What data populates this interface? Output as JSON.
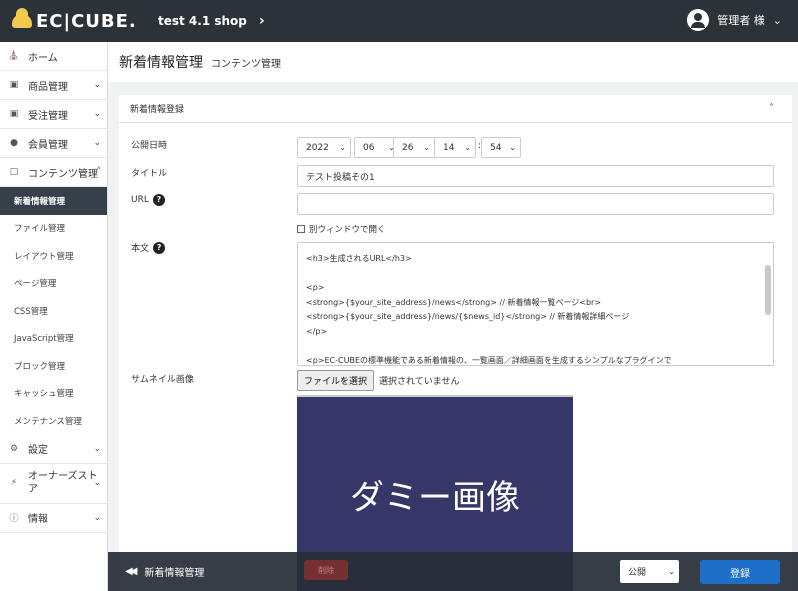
{
  "topbar": {
    "logo_text": "EC|CUBE.",
    "shop_name": "test 4.1 shop",
    "user_name": "管理者 様"
  },
  "sidebar": {
    "items": [
      {
        "label": "ホーム",
        "icon": "home-icon",
        "chevron": ""
      },
      {
        "label": "商品管理",
        "icon": "box-icon",
        "chevron": "⌄"
      },
      {
        "label": "受注管理",
        "icon": "cart-icon",
        "chevron": "⌄"
      },
      {
        "label": "会員管理",
        "icon": "users-icon",
        "chevron": "⌄"
      },
      {
        "label": "コンテンツ管理",
        "icon": "file-icon",
        "chevron": "^"
      }
    ],
    "subitems": [
      "新着情報管理",
      "ファイル管理",
      "レイアウト管理",
      "ページ管理",
      "CSS管理",
      "JavaScript管理",
      "ブロック管理",
      "キャッシュ管理",
      "メンテナンス管理"
    ],
    "items_after": [
      {
        "label": "設定",
        "icon": "gear-icon",
        "chevron": "⌄"
      },
      {
        "label": "オーナーズストア",
        "icon": "plug-icon",
        "chevron": "⌄"
      },
      {
        "label": "情報",
        "icon": "info-icon",
        "chevron": "⌄"
      }
    ]
  },
  "page": {
    "title": "新着情報管理",
    "subtitle": "コンテンツ管理"
  },
  "form": {
    "card_title": "新着情報登録",
    "date_label": "公開日時",
    "year": "2022",
    "month": "06",
    "day": "26",
    "hour": "14",
    "minute": "54",
    "colon": ":",
    "title_label": "タイトル",
    "title_value": "テスト投稿その1",
    "url_label": "URL",
    "url_value": "",
    "new_window_label": "別ウィンドウで開く",
    "body_label": "本文",
    "body_lines": [
      "<h3>生成されるURL</h3>",
      "",
      "<p>",
      "<strong>{$your_site_address}/news</strong> // 新着情報一覧ページ<br>",
      "<strong>{$your_site_address}/news/{$news_id}</strong> // 新着情報詳細ページ",
      "</p>",
      "",
      "<p>EC-CUBEの標準機能である新着情報の、一覧画面／詳細画面を生成するシンプルなプラグインで"
    ],
    "thumb_label": "サムネイル画像",
    "file_button": "ファイルを選択",
    "file_status": "選択されていません",
    "thumb_text": "ダミー画像",
    "delete_button": "削除"
  },
  "bottom": {
    "back_label": "新着情報管理",
    "status_value": "公開",
    "register_button": "登録"
  },
  "colors": {
    "topbar": "#2b3339",
    "accent": "#1e6fc8",
    "thumb_bg": "#343767"
  }
}
